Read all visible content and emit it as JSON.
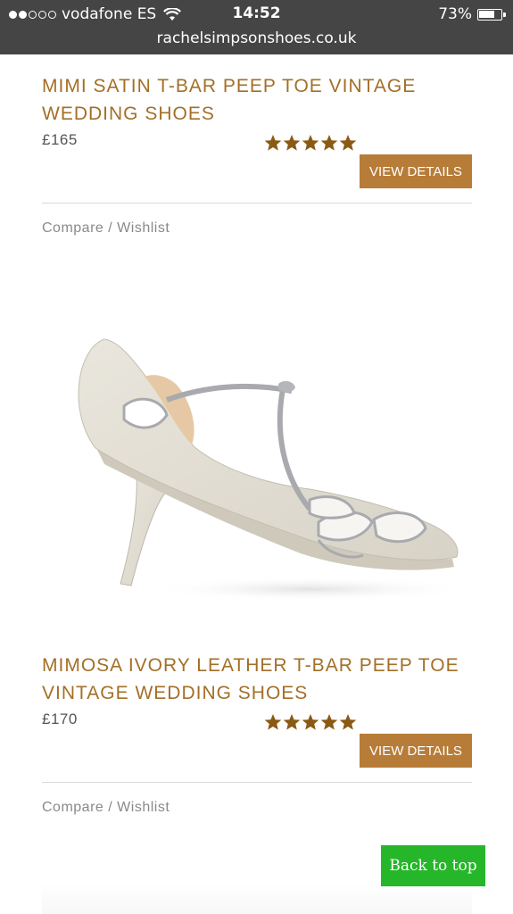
{
  "status_bar": {
    "carrier": "vodafone ES",
    "time": "14:52",
    "battery": "73%",
    "battery_level": 0.73,
    "url": "rachelsimpsonshoes.co.uk",
    "signal_strength": 2,
    "signal_max": 5
  },
  "products": [
    {
      "title_line1": "MIMI SATIN T-BAR PEEP TOE VINTAGE",
      "title_line2": "WEDDING SHOES",
      "price": "£165",
      "rating": 5,
      "rating_max": 5,
      "view_label": "VIEW DETAILS",
      "compare_label": "Compare",
      "separator": " / ",
      "wishlist_label": "Wishlist"
    },
    {
      "title_line1": "MIMOSA IVORY LEATHER T-BAR PEEP TOE",
      "title_line2": "VINTAGE WEDDING SHOES",
      "price": "£170",
      "rating": 5,
      "rating_max": 5,
      "view_label": "VIEW DETAILS",
      "compare_label": "Compare",
      "separator": " / ",
      "wishlist_label": "Wishlist"
    }
  ],
  "back_to_top": "Back to top",
  "colors": {
    "accent": "#a36f27",
    "button": "#b77c38",
    "star": "#8a5a14",
    "back_to_top": "#26b62a",
    "status_bar": "#454545"
  }
}
